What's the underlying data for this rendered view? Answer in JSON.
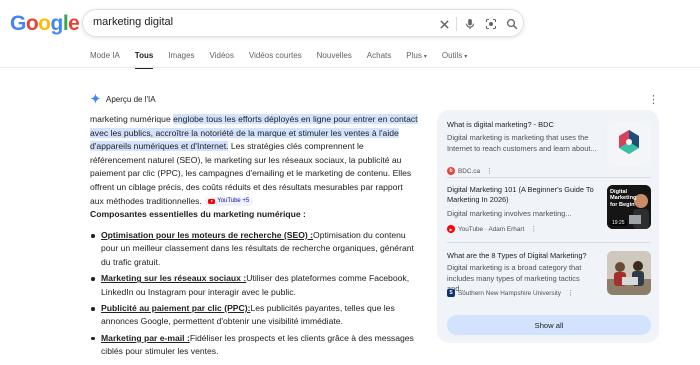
{
  "logo": {
    "letters": [
      "G",
      "o",
      "o",
      "g",
      "l",
      "e"
    ],
    "colors": [
      "#4285F4",
      "#EA4335",
      "#FBBC05",
      "#4285F4",
      "#34A853",
      "#EA4335"
    ]
  },
  "search": {
    "query": "marketing digital",
    "icons": [
      "close-icon",
      "microphone-icon",
      "lens-icon",
      "search-icon"
    ]
  },
  "tabs": [
    {
      "label": "Mode IA"
    },
    {
      "label": "Tous",
      "active": true
    },
    {
      "label": "Images"
    },
    {
      "label": "Vidéos"
    },
    {
      "label": "Vidéos courtes"
    },
    {
      "label": "Nouvelles"
    },
    {
      "label": "Achats"
    },
    {
      "label": "Plus",
      "caret": "▾"
    },
    {
      "label": "Outils",
      "caret": "▾"
    }
  ],
  "ai_overview": {
    "label": "Aperçu de l'IA",
    "para_start": "marketing numérique ",
    "para_highlight": "englobe tous les efforts déployés en ligne pour entrer en contact avec les publics, accroître la notoriété de la marque et stimuler les ventes à l'aide d'appareils numériques et d'Internet.",
    "para_rest": " Les stratégies clés comprennent le référencement naturel (SEO), le marketing sur les réseaux sociaux, la publicité au paiement par clic (PPC), les campagnes d'emailing et le marketing de contenu. Elles offrent un ciblage précis, des coûts réduits et des résultats mesurables par rapport aux méthodes traditionnelles.",
    "chip": "YouTube +5",
    "section_title": "Composantes essentielles du marketing numérique :",
    "bullets": [
      {
        "term": "Optimisation pour les moteurs de recherche (SEO) :",
        "text": "Optimisation du contenu pour un meilleur classement dans les résultats de recherche organiques, générant du trafic gratuit."
      },
      {
        "term": "Marketing sur les réseaux sociaux :",
        "text": "Utiliser des plateformes comme Facebook, LinkedIn ou Instagram pour interagir avec le public."
      },
      {
        "term": "Publicité au paiement par clic (PPC):",
        "text": "Les publicités payantes, telles que les annonces Google, permettent d'obtenir une visibilité immédiate."
      },
      {
        "term": "Marketing par e-mail :",
        "text": "Fidéliser les prospects et les clients grâce à des messages ciblés pour stimuler les ventes."
      }
    ]
  },
  "sources": {
    "cards": [
      {
        "title": "What is digital marketing? - BDC",
        "snippet": "Digital marketing is marketing that uses the Internet to reach customers and learn about...",
        "site": "BDC.ca",
        "favicon_color": "#e8453c",
        "favicon_letter": "b"
      },
      {
        "title": "Digital Marketing 101 (A Beginner's Guide To Marketing In 2026)",
        "snippet": "Digital marketing involves marketing...",
        "site": "YouTube · Adam Erhart",
        "favicon_color": "#ff0000",
        "favicon_letter": "▶",
        "thumb_text": "Digital Marketing for Begin",
        "thumb_time": "19:25"
      },
      {
        "title": "What are the 8 Types of Digital Marketing?",
        "snippet": "Digital marketing is a broad category that includes many types of marketing tactics and...",
        "site": "Southern New Hampshire University",
        "favicon_color": "#0a3370",
        "favicon_letter": "S"
      }
    ],
    "show_all": "Show all"
  }
}
